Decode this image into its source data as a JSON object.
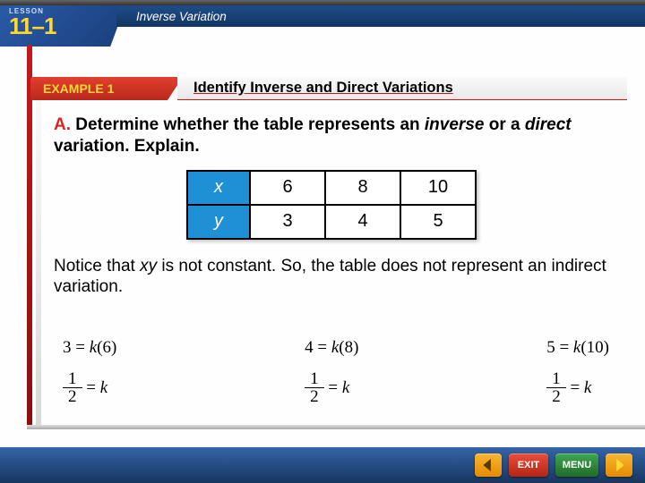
{
  "lesson": {
    "label": "LESSON",
    "number": "11–1",
    "topic": "Inverse Variation"
  },
  "example": {
    "tab": "EXAMPLE 1",
    "title": "Identify Inverse and Direct Variations"
  },
  "prompt": {
    "lead": "A.",
    "text1": " Determine whether the table represents an ",
    "em1": "inverse",
    "text2": " or a ",
    "em2": "direct",
    "text3": " variation. Explain."
  },
  "table": {
    "row1_label": "x",
    "row2_label": "y",
    "r1c1": "6",
    "r1c2": "8",
    "r1c3": "10",
    "r2c1": "3",
    "r2c2": "4",
    "r2c3": "5"
  },
  "note": {
    "t1": "Notice that ",
    "xy": "xy",
    "t2": " is not constant. So, the table does not represent an indirect variation."
  },
  "equations": {
    "e1_top": "3 = k(6)",
    "e1_bot_eq": " = k",
    "e2_top": "4 = k(8)",
    "e2_bot_eq": " = k",
    "e3_top": "5 = k(10)",
    "e3_bot_eq": " = k",
    "frac_n": "1",
    "frac_d": "2"
  },
  "footer": {
    "exit": "EXIT",
    "menu": "MENU"
  }
}
